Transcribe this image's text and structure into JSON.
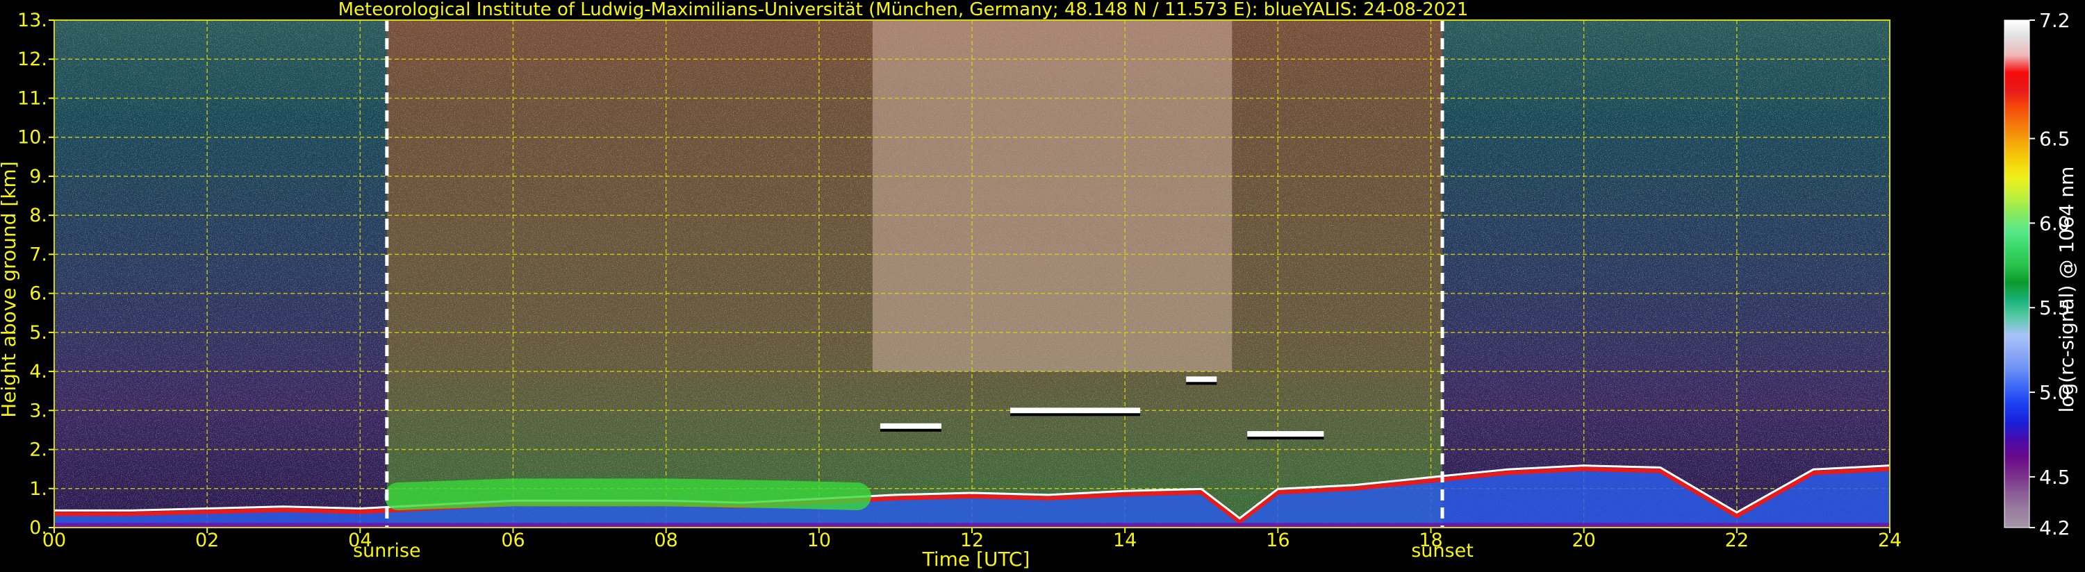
{
  "chart_data": {
    "type": "heatmap",
    "title": "Meteorological Institute of Ludwig-Maximilians-Universität (München, Germany; 48.148 N / 11.573 E):    blueYALIS: 24-08-2021",
    "xlabel": "Time [UTC]",
    "ylabel": "Height above ground [km]",
    "xlim": [
      0,
      24
    ],
    "ylim": [
      0,
      13
    ],
    "x_ticks": [
      "00",
      "02",
      "04",
      "06",
      "08",
      "10",
      "12",
      "14",
      "16",
      "18",
      "20",
      "22",
      "24"
    ],
    "y_ticks": [
      "0.",
      "1.",
      "2.",
      "3.",
      "4.",
      "5.",
      "6.",
      "7.",
      "8.",
      "9.",
      "10.",
      "11.",
      "12.",
      "13."
    ],
    "grid": true,
    "annotations": [
      {
        "label": "sunrise",
        "x": 4.35
      },
      {
        "label": "sunset",
        "x": 18.15
      }
    ],
    "colorbar": {
      "label": "log(rc-signal) @ 1064 nm",
      "range": [
        4.2,
        7.2
      ],
      "ticks": [
        "4.2",
        "4.5",
        "5.0",
        "5.5",
        "6.0",
        "6.5",
        "7.2"
      ],
      "colors": [
        "#a596a8",
        "#9a7ea0",
        "#8a5a95",
        "#7a2f8c",
        "#6a0a8a",
        "#4a0aa8",
        "#1a20d8",
        "#1a3cf0",
        "#3a66f5",
        "#6a8ef5",
        "#8eaaf5",
        "#a8c2f8",
        "#5acaa8",
        "#1ab27a",
        "#0a9a2a",
        "#2ac24a",
        "#3ad86a",
        "#5ae88a",
        "#8ae85a",
        "#c2f03a",
        "#eef01a",
        "#f5d00a",
        "#f5a80a",
        "#f57a0a",
        "#f54a0a",
        "#e81a1a",
        "#f50a0a",
        "#f0b8b8",
        "#e0e0e0",
        "#ffffff"
      ]
    },
    "signal_features": {
      "boundary_layer_top_km": [
        [
          0,
          0.35
        ],
        [
          1,
          0.35
        ],
        [
          2,
          0.4
        ],
        [
          3,
          0.45
        ],
        [
          4,
          0.4
        ],
        [
          5,
          0.5
        ],
        [
          6,
          0.6
        ],
        [
          7,
          0.6
        ],
        [
          8,
          0.6
        ],
        [
          9,
          0.55
        ],
        [
          10,
          0.65
        ],
        [
          11,
          0.75
        ],
        [
          12,
          0.8
        ],
        [
          13,
          0.75
        ],
        [
          14,
          0.85
        ],
        [
          15,
          0.9
        ],
        [
          15.5,
          0.15
        ],
        [
          16,
          0.9
        ],
        [
          17,
          1.0
        ],
        [
          18,
          1.2
        ],
        [
          19,
          1.4
        ],
        [
          20,
          1.5
        ],
        [
          21,
          1.45
        ],
        [
          22,
          0.3
        ],
        [
          23,
          1.4
        ],
        [
          24,
          1.5
        ]
      ],
      "aerosol_layer_km": [
        [
          4.5,
          0.8
        ],
        [
          6,
          0.9
        ],
        [
          8,
          0.9
        ],
        [
          9.5,
          0.85
        ],
        [
          10.5,
          0.8
        ]
      ],
      "clouds": [
        {
          "t_start": 10.8,
          "t_end": 11.6,
          "height_km": 2.6
        },
        {
          "t_start": 12.5,
          "t_end": 14.2,
          "height_km": 3.0
        },
        {
          "t_start": 14.8,
          "t_end": 15.2,
          "height_km": 3.8
        },
        {
          "t_start": 15.6,
          "t_end": 16.6,
          "height_km": 2.4
        }
      ],
      "high_signal_daytime_band_utc": [
        10.7,
        15.4
      ]
    }
  }
}
